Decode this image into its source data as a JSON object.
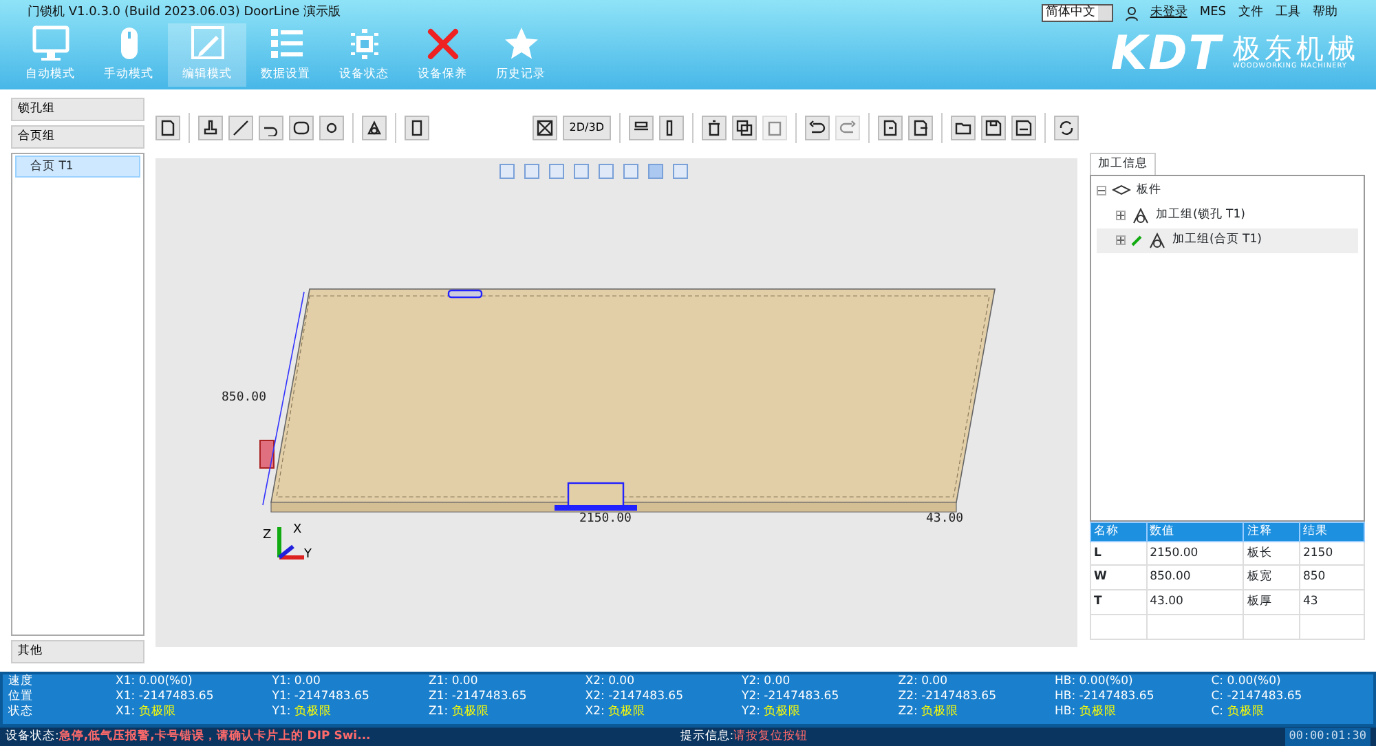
{
  "window": {
    "title": "门锁机  V1.0.3.0  (Build 2023.06.03)  DoorLine  演示版"
  },
  "top_menu": {
    "language": "简体中文",
    "user": "未登录",
    "items": [
      "MES",
      "文件",
      "工具",
      "帮助"
    ]
  },
  "logo": {
    "brand": "KDT",
    "name": "极东机械",
    "tagline": "WOODWORKING MACHINERY"
  },
  "nav": [
    {
      "label": "自动模式",
      "selected": false
    },
    {
      "label": "手动模式",
      "selected": false
    },
    {
      "label": "编辑模式",
      "selected": true
    },
    {
      "label": "数据设置",
      "selected": false
    },
    {
      "label": "设备状态",
      "selected": false
    },
    {
      "label": "设备保养",
      "selected": false
    },
    {
      "label": "历史记录",
      "selected": false
    }
  ],
  "left_panel": {
    "groups": [
      "锁孔组",
      "合页组"
    ],
    "items": [
      {
        "label": "合页 T1",
        "selected": true
      }
    ],
    "footer": "其他"
  },
  "toolbar": {
    "view_toggle": "2D/3D"
  },
  "canvas": {
    "width_dim": "2150.00",
    "height_dim": "850.00",
    "thickness_dim": "43.00",
    "axes": [
      "Z",
      "X",
      "Y"
    ]
  },
  "right_panel": {
    "tab": "加工信息",
    "tree": [
      {
        "label": "板件",
        "expanded": true,
        "selected": false,
        "children": [
          {
            "label": "加工组(锁孔 T1)",
            "expanded": false,
            "selected": false
          },
          {
            "label": "加工组(合页 T1)",
            "expanded": false,
            "selected": true
          }
        ]
      }
    ],
    "table": {
      "columns": [
        "名称",
        "数值",
        "注释",
        "结果"
      ],
      "rows": [
        [
          "L",
          "2150.00",
          "板长",
          "2150"
        ],
        [
          "W",
          "850.00",
          "板宽",
          "850"
        ],
        [
          "T",
          "43.00",
          "板厚",
          "43"
        ]
      ]
    }
  },
  "axes_status": [
    {
      "label": "速度",
      "cells": [
        {
          "axis": "X1:",
          "value": "0.00(%0)",
          "warn": false
        },
        {
          "axis": "Y1:",
          "value": "0.00",
          "warn": false
        },
        {
          "axis": "Z1:",
          "value": "0.00",
          "warn": false
        },
        {
          "axis": "X2:",
          "value": "0.00",
          "warn": false
        },
        {
          "axis": "Y2:",
          "value": "0.00",
          "warn": false
        },
        {
          "axis": "Z2:",
          "value": "0.00",
          "warn": false
        },
        {
          "axis": "HB:",
          "value": "0.00(%0)",
          "warn": false
        },
        {
          "axis": "C:",
          "value": "0.00(%0)",
          "warn": false
        }
      ]
    },
    {
      "label": "位置",
      "cells": [
        {
          "axis": "X1:",
          "value": "-2147483.65",
          "warn": false
        },
        {
          "axis": "Y1:",
          "value": "-2147483.65",
          "warn": false
        },
        {
          "axis": "Z1:",
          "value": "-2147483.65",
          "warn": false
        },
        {
          "axis": "X2:",
          "value": "-2147483.65",
          "warn": false
        },
        {
          "axis": "Y2:",
          "value": "-2147483.65",
          "warn": false
        },
        {
          "axis": "Z2:",
          "value": "-2147483.65",
          "warn": false
        },
        {
          "axis": "HB:",
          "value": "-2147483.65",
          "warn": false
        },
        {
          "axis": "C:",
          "value": "-2147483.65",
          "warn": false
        }
      ]
    },
    {
      "label": "状态",
      "cells": [
        {
          "axis": "X1:",
          "value": "负极限",
          "warn": true
        },
        {
          "axis": "Y1:",
          "value": "负极限",
          "warn": true
        },
        {
          "axis": "Z1:",
          "value": "负极限",
          "warn": true
        },
        {
          "axis": "X2:",
          "value": "负极限",
          "warn": true
        },
        {
          "axis": "Y2:",
          "value": "负极限",
          "warn": true
        },
        {
          "axis": "Z2:",
          "value": "负极限",
          "warn": true
        },
        {
          "axis": "HB:",
          "value": "负极限",
          "warn": true
        },
        {
          "axis": "C:",
          "value": "负极限",
          "warn": true
        }
      ]
    }
  ],
  "status_bar": {
    "device_label": "设备状态:",
    "device_text": "急停,低气压报警,卡号错误，请确认卡片上的 DIP Swi...",
    "hint_label": "提示信息:",
    "hint_text": "请按复位按钮",
    "time": "00:00:01:30"
  }
}
